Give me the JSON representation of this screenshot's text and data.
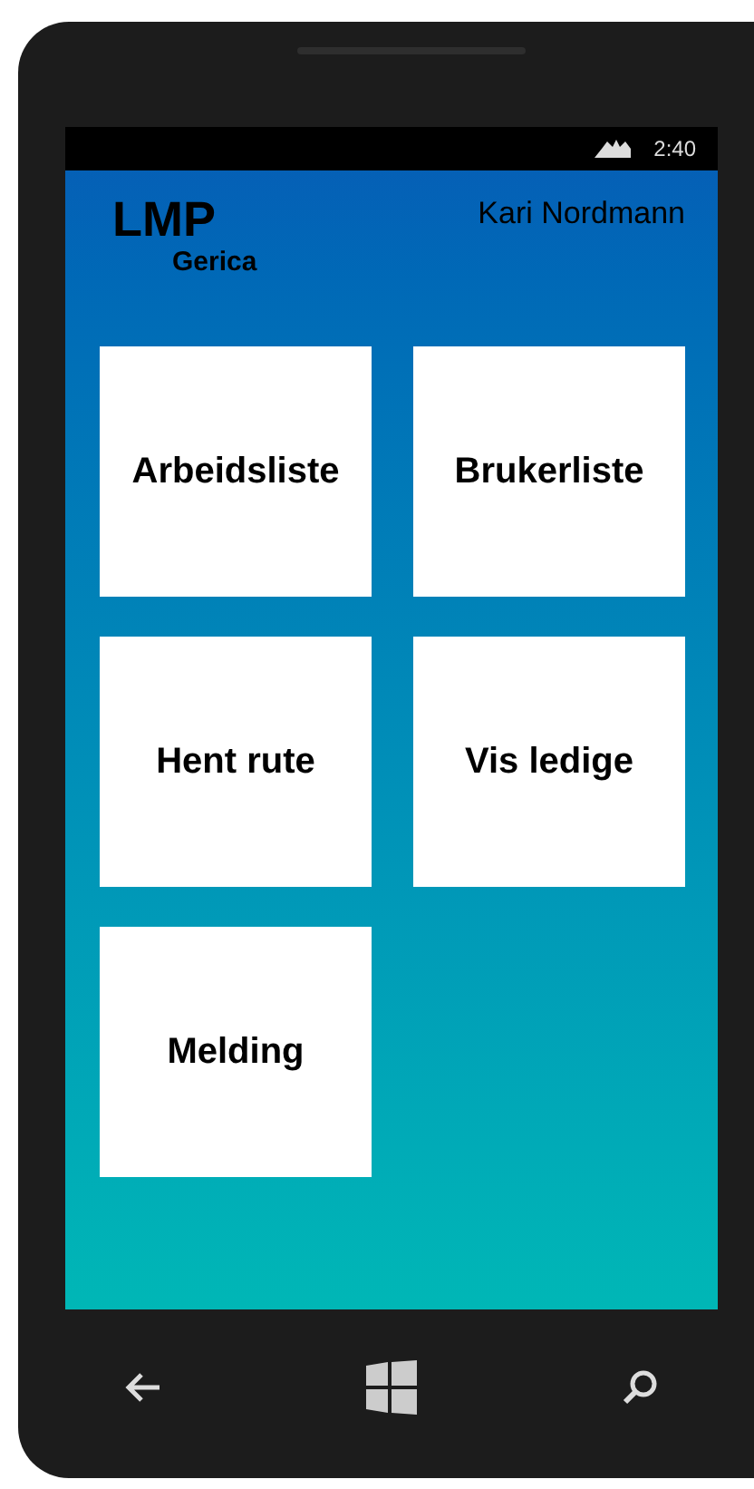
{
  "status_bar": {
    "time": "2:40"
  },
  "header": {
    "title": "LMP",
    "subtitle": "Gerica",
    "user": "Kari Nordmann"
  },
  "tiles": [
    {
      "label": "Arbeidsliste"
    },
    {
      "label": "Brukerliste"
    },
    {
      "label": "Hent rute"
    },
    {
      "label": "Vis ledige"
    },
    {
      "label": "Melding"
    }
  ]
}
